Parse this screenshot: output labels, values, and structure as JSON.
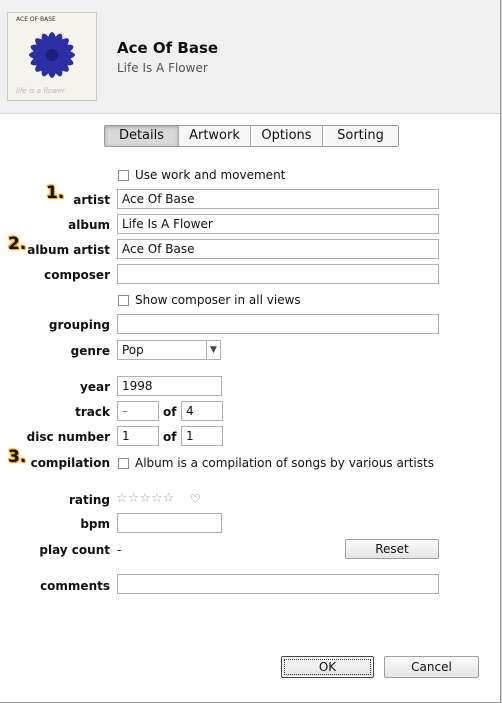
{
  "header": {
    "title": "Ace Of Base",
    "subtitle": "Life Is A Flower",
    "artwork_band": "ACE OF BASE",
    "artwork_caption": "life is a flower"
  },
  "tabs": [
    {
      "label": "Details"
    },
    {
      "label": "Artwork"
    },
    {
      "label": "Options"
    },
    {
      "label": "Sorting"
    }
  ],
  "badges": [
    "1.",
    "2.",
    "3."
  ],
  "fields": {
    "use_work_label": "Use work and movement",
    "artist_label": "artist",
    "artist_value": "Ace Of Base",
    "album_label": "album",
    "album_value": "Life Is A Flower",
    "album_artist_label": "album artist",
    "album_artist_value": "Ace Of Base",
    "composer_label": "composer",
    "composer_value": "",
    "show_composer_label": "Show composer in all views",
    "grouping_label": "grouping",
    "grouping_value": "",
    "genre_label": "genre",
    "genre_value": "Pop",
    "year_label": "year",
    "year_value": "1998",
    "track_label": "track",
    "track_value": "–",
    "track_of_value": "4",
    "disc_label": "disc number",
    "disc_value": "1",
    "disc_of_value": "1",
    "of_label": "of",
    "compilation_label": "compilation",
    "compilation_text": "Album is a compilation of songs by various artists",
    "rating_label": "rating",
    "rating_stars": "☆☆☆☆☆",
    "heart": "♡",
    "bpm_label": "bpm",
    "bpm_value": "",
    "play_count_label": "play count",
    "play_count_value": "-",
    "reset_label": "Reset",
    "comments_label": "comments",
    "comments_value": ""
  },
  "buttons": {
    "ok": "OK",
    "cancel": "Cancel"
  },
  "colors": {
    "badge_accent": "#f7a900",
    "flower": "#2b2fa3"
  }
}
